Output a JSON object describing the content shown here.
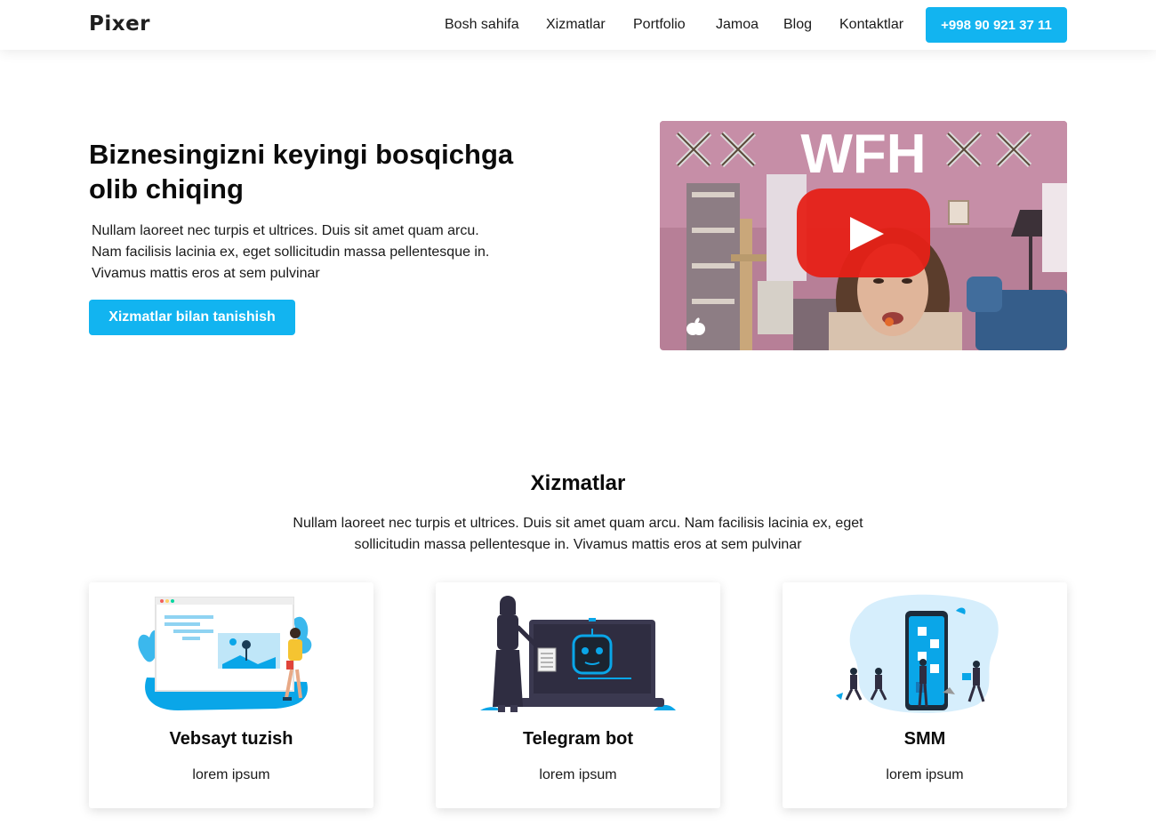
{
  "header": {
    "logo": "Pixer",
    "nav": [
      {
        "label": "Bosh sahifa"
      },
      {
        "label": "Xizmatlar"
      },
      {
        "label": "Portfolio"
      },
      {
        "label": "Jamoa"
      },
      {
        "label": "Blog"
      },
      {
        "label": "Kontaktlar"
      }
    ],
    "phone": "+998 90 921 37 11"
  },
  "hero": {
    "title": "Biznesingizni keyingi bosqichga olib chiqing",
    "text": "Nullam laoreet nec turpis et ultrices. Duis sit amet quam arcu. Nam facilisis lacinia ex, eget sollicitudin massa pellentesque in. Vivamus mattis eros at sem pulvinar",
    "button": "Xizmatlar bilan tanishish",
    "video": {
      "overlay_text": "WFH",
      "icons": [
        "crossed-swords-icon",
        "youtube-play-icon",
        "apple-icon"
      ]
    }
  },
  "services": {
    "title": "Xizmatlar",
    "text": "Nullam laoreet nec turpis et ultrices. Duis sit amet quam arcu. Nam facilisis lacinia ex, eget sollicitudin massa pellentesque in. Vivamus mattis eros at sem pulvinar",
    "cards": [
      {
        "title": "Vebsayt tuzish",
        "text": "lorem ipsum"
      },
      {
        "title": "Telegram bot",
        "text": "lorem ipsum"
      },
      {
        "title": "SMM",
        "text": "lorem ipsum"
      }
    ]
  },
  "colors": {
    "accent": "#12b4f0",
    "text": "#0b0b0b",
    "youtube_red": "#e62117"
  }
}
